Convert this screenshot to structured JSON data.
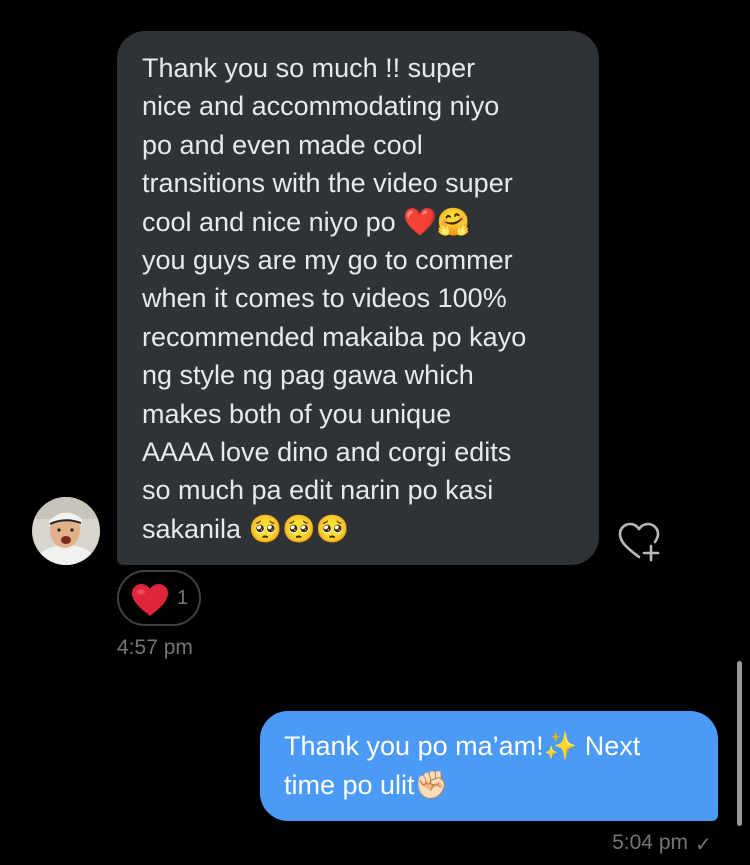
{
  "conversation": {
    "incoming_message": {
      "text": "Thank you so much !! super\nnice and accommodating niyo\npo and even made cool\ntransitions with the video super\ncool and nice niyo po ❤️🤗\nyou guys are my go to commer\nwhen it comes to videos 100%\nrecommended makaiba po kayo\nng style ng pag gawa which\nmakes both of you unique\nAAAA love dino and corgi edits\nso much pa edit narin po kasi\nsakanila 🥺🥺🥺",
      "timestamp": "4:57 pm",
      "reaction": {
        "emoji_icon": "red-heart-icon",
        "count": "1"
      }
    },
    "outgoing_message": {
      "text": "Thank you po ma’am!✨ Next\ntime po ulit✊🏻",
      "timestamp": "5:04 pm",
      "status_icon": "check-icon",
      "status_glyph": "✓"
    }
  },
  "colors": {
    "background": "#000000",
    "incoming_bubble": "#2f3336",
    "outgoing_bubble": "#4b9af5",
    "secondary_text": "#71767b",
    "heart": "#e0243c"
  }
}
